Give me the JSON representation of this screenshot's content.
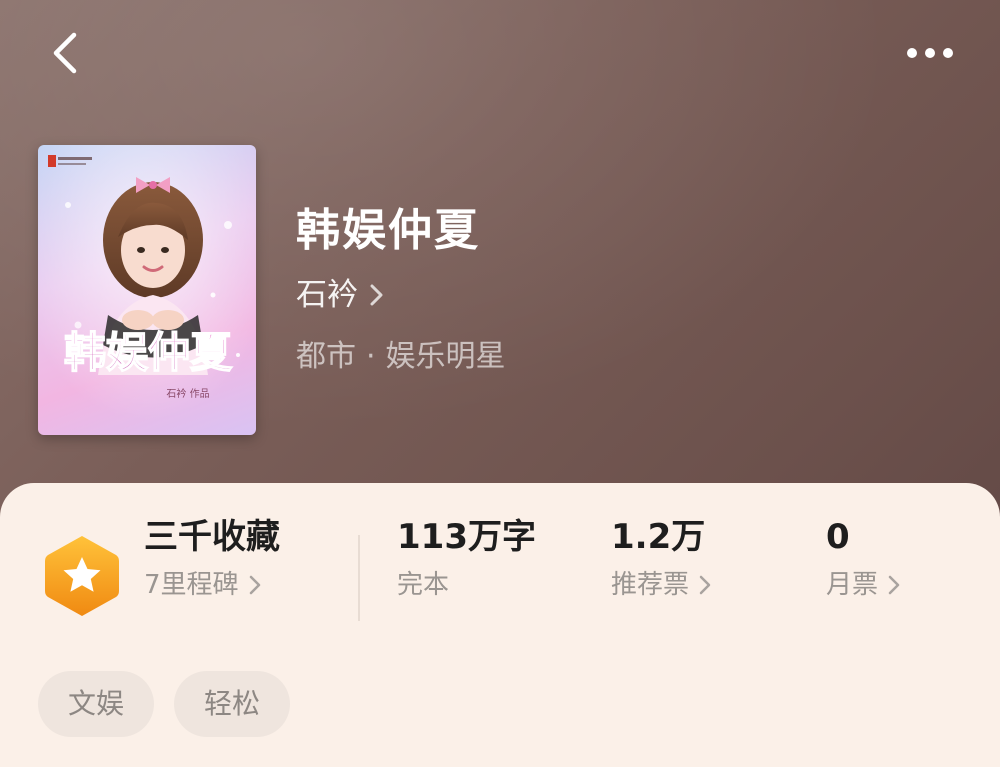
{
  "header": {
    "back_icon": "chevron-left-icon",
    "more_icon": "more-horizontal-icon"
  },
  "book": {
    "title": "韩娱仲夏",
    "author": "石衿",
    "category": "都市",
    "separator": "·",
    "subcategory": "娱乐明星",
    "cover": {
      "title_art": "韩娱仲夏",
      "byline": "石衿 作品"
    }
  },
  "stats": {
    "collection": {
      "value": "三千收藏",
      "label": "7里程碑",
      "icon": "star-badge-icon",
      "badge_color": "#f7a51e"
    },
    "words": {
      "value": "113万字",
      "label": "完本"
    },
    "recommend": {
      "value": "1.2万",
      "label": "推荐票"
    },
    "monthly": {
      "value": "0",
      "label": "月票"
    }
  },
  "tags": [
    "文娱",
    "轻松"
  ],
  "colors": {
    "header_bg": "#7a5e58",
    "sheet_bg": "#fbf0e8",
    "tag_bg": "#efe5de"
  }
}
